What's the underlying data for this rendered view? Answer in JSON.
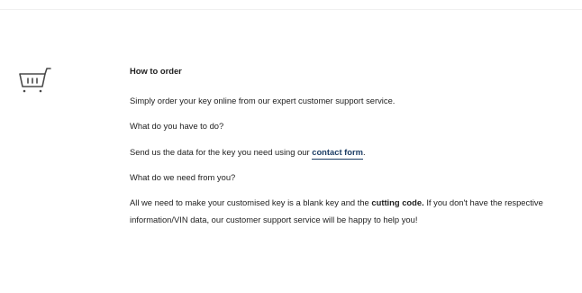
{
  "order": {
    "heading": "How to order",
    "intro": "Simply order your key online from our expert customer support service.",
    "question1": "What do you have to do?",
    "send_prefix": "Send us the data for the key you need using our ",
    "contact_link": "contact form",
    "send_suffix": ".",
    "question2": "What do we need from you?",
    "answer_prefix": "All we need to make your customised key is a blank key and the ",
    "answer_bold": "cutting code.",
    "answer_suffix": " If you don't have the respective information/VIN data, our customer support service will be happy to help you!"
  },
  "icons": {
    "cart": "shopping-cart-icon"
  },
  "colors": {
    "text": "#1e1e1e",
    "link": "#1d3e66",
    "icon": "#4a4a4a"
  }
}
